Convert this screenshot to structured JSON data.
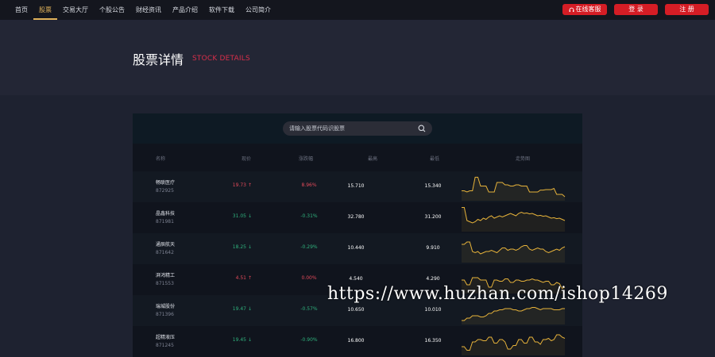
{
  "nav": {
    "items": [
      {
        "label": "首页",
        "active": false
      },
      {
        "label": "股票",
        "active": true
      },
      {
        "label": "交易大厅",
        "active": false
      },
      {
        "label": "个股公告",
        "active": false
      },
      {
        "label": "财经资讯",
        "active": false
      },
      {
        "label": "产品介绍",
        "active": false
      },
      {
        "label": "软件下载",
        "active": false
      },
      {
        "label": "公司简介",
        "active": false
      }
    ],
    "service_label": "在线客服",
    "login_label": "登 录",
    "register_label": "注 册"
  },
  "hero": {
    "title": "股票详情",
    "subtitle": "STOCK DETAILS"
  },
  "search": {
    "placeholder": "请输入股票代码识股票"
  },
  "table": {
    "headers": [
      "名称",
      "现价",
      "涨跌幅",
      "最高",
      "最低",
      "走势图"
    ],
    "rows": [
      {
        "name": "畅联医疗",
        "code": "872925",
        "price": "19.73",
        "direction": "up",
        "change": "8.96%",
        "high": "15.710",
        "low": "15.340",
        "trend": [
          0.35,
          0.35,
          0.3,
          0.35,
          0.35,
          0.92,
          0.92,
          0.55,
          0.55,
          0.55,
          0.3,
          0.3,
          0.3,
          0.7,
          0.7,
          0.7,
          0.6,
          0.6,
          0.55,
          0.55,
          0.6,
          0.6,
          0.55,
          0.55,
          0.55,
          0.3,
          0.3,
          0.3,
          0.3,
          0.38,
          0.38,
          0.4,
          0.4,
          0.4,
          0.45,
          0.2,
          0.2,
          0.2,
          0.1
        ]
      },
      {
        "name": "晶鑫科技",
        "code": "871981",
        "price": "31.05",
        "direction": "down",
        "change": "-0.31%",
        "high": "32.780",
        "low": "31.200",
        "trend": [
          0.95,
          0.95,
          0.4,
          0.35,
          0.3,
          0.35,
          0.45,
          0.4,
          0.5,
          0.45,
          0.55,
          0.6,
          0.5,
          0.55,
          0.6,
          0.55,
          0.6,
          0.65,
          0.7,
          0.65,
          0.6,
          0.7,
          0.75,
          0.7,
          0.72,
          0.68,
          0.7,
          0.65,
          0.6,
          0.62,
          0.58,
          0.6,
          0.55,
          0.5,
          0.52,
          0.48,
          0.5,
          0.45,
          0.4
        ]
      },
      {
        "name": "通辰航天",
        "code": "871642",
        "price": "18.25",
        "direction": "down",
        "change": "-0.29%",
        "high": "10.440",
        "low": "9.910",
        "trend": [
          0.7,
          0.7,
          0.8,
          0.8,
          0.4,
          0.35,
          0.4,
          0.3,
          0.35,
          0.4,
          0.4,
          0.45,
          0.4,
          0.35,
          0.45,
          0.55,
          0.55,
          0.45,
          0.5,
          0.5,
          0.45,
          0.5,
          0.6,
          0.65,
          0.65,
          0.5,
          0.45,
          0.5,
          0.55,
          0.5,
          0.5,
          0.4,
          0.35,
          0.4,
          0.45,
          0.5,
          0.45,
          0.55,
          0.6
        ]
      },
      {
        "name": "湃鸿精工",
        "code": "871553",
        "price": "4.51",
        "direction": "up",
        "change": "0.00%",
        "high": "4.540",
        "low": "4.290",
        "trend": [
          0.5,
          0.5,
          0.3,
          0.3,
          0.6,
          0.6,
          0.6,
          0.5,
          0.5,
          0.5,
          0.2,
          0.2,
          0.5,
          0.5,
          0.45,
          0.45,
          0.55,
          0.55,
          0.4,
          0.4,
          0.5,
          0.5,
          0.45,
          0.45,
          0.5,
          0.5,
          0.55,
          0.5,
          0.5,
          0.45,
          0.4,
          0.45,
          0.45,
          0.3,
          0.3,
          0.4,
          0.35,
          0.15,
          0.2
        ]
      },
      {
        "name": "瑞城股份",
        "code": "871396",
        "price": "19.47",
        "direction": "down",
        "change": "-0.57%",
        "high": "10.650",
        "low": "10.010",
        "trend": [
          0.1,
          0.1,
          0.2,
          0.2,
          0.3,
          0.3,
          0.3,
          0.25,
          0.25,
          0.3,
          0.4,
          0.4,
          0.5,
          0.5,
          0.55,
          0.55,
          0.6,
          0.6,
          0.6,
          0.55,
          0.55,
          0.5,
          0.5,
          0.55,
          0.6,
          0.6,
          0.65,
          0.65,
          0.6,
          0.55,
          0.6,
          0.6,
          0.6,
          0.6,
          0.55,
          0.55,
          0.55,
          0.6,
          0.6
        ]
      },
      {
        "name": "超精液压",
        "code": "871245",
        "price": "19.45",
        "direction": "down",
        "change": "-0.90%",
        "high": "16.800",
        "low": "16.350",
        "trend": [
          0.3,
          0.3,
          0.15,
          0.15,
          0.5,
          0.5,
          0.6,
          0.6,
          0.55,
          0.55,
          0.7,
          0.7,
          0.45,
          0.45,
          0.6,
          0.6,
          0.5,
          0.2,
          0.2,
          0.35,
          0.35,
          0.6,
          0.6,
          0.45,
          0.45,
          0.7,
          0.7,
          0.5,
          0.5,
          0.4,
          0.6,
          0.6,
          0.65,
          0.55,
          0.6,
          0.8,
          0.8,
          0.7,
          0.65
        ]
      }
    ]
  },
  "colors": {
    "accent": "#e0b25a",
    "brand_red": "#d51d25",
    "up": "#e34a5a",
    "down": "#2fb27d",
    "trend_line": "#e6b23a"
  },
  "watermark": "https://www.huzhan.com/ishop14269"
}
